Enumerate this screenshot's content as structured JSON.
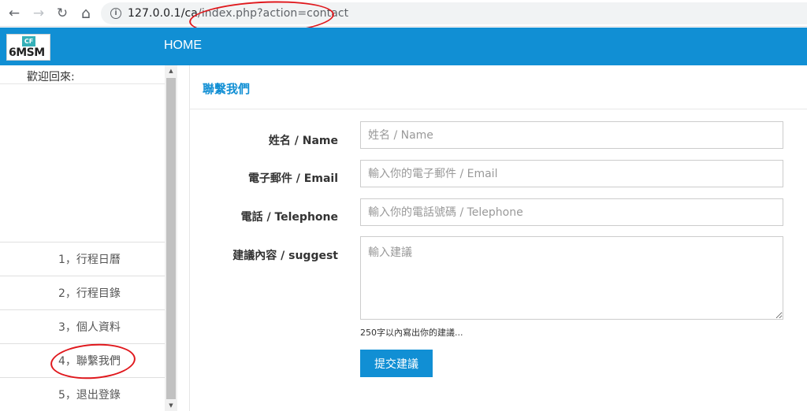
{
  "browser": {
    "url_host": "127.0.0.1/ca",
    "url_path": "/index.php?action=contact",
    "back_icon": "←",
    "forward_icon": "→",
    "reload_icon": "↻",
    "home_icon": "⌂"
  },
  "topbar": {
    "logo_mark": "CF",
    "logo_text": "6MSM",
    "home_label": "HOME",
    "color": "#118fd4"
  },
  "sidebar": {
    "welcome": "歡迎回來:",
    "items": [
      {
        "label": "1，行程日曆"
      },
      {
        "label": "2，行程目錄"
      },
      {
        "label": "3，個人資料"
      },
      {
        "label": "4，聯繫我們"
      },
      {
        "label": "5，退出登錄"
      }
    ]
  },
  "main": {
    "title": "聯繫我們",
    "fields": {
      "name_label": "姓名 / Name",
      "name_placeholder": "姓名 / Name",
      "email_label": "電子郵件 / Email",
      "email_placeholder": "輸入你的電子郵件 / Email",
      "phone_label": "電話 / Telephone",
      "phone_placeholder": "輸入你的電話號碼 / Telephone",
      "suggest_label": "建議內容 / suggest",
      "suggest_placeholder": "輸入建議"
    },
    "help_text": "250字以內寫出你的建議...",
    "submit_label": "提交建議"
  },
  "colors": {
    "accent": "#118fd4",
    "annotation": "#e0181d"
  }
}
